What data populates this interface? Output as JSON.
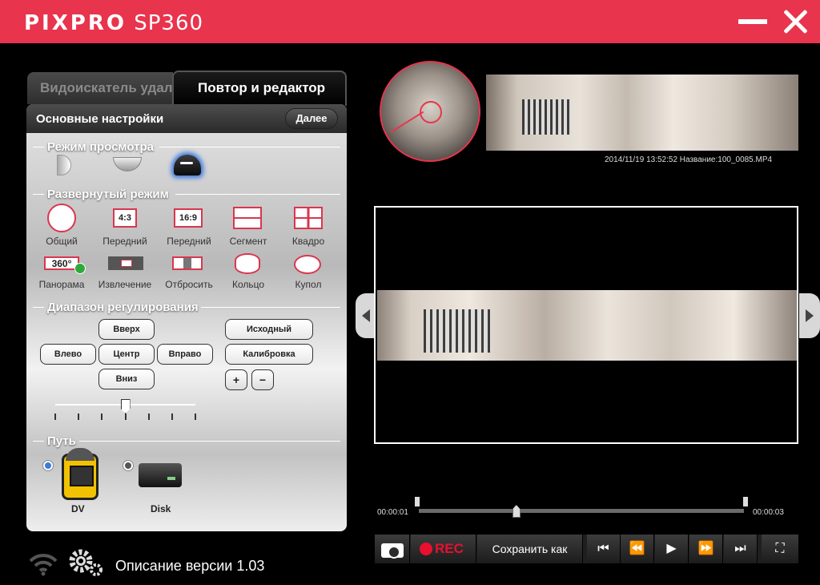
{
  "app": {
    "brand": "PIXPRO",
    "model": "SP360"
  },
  "tabs": {
    "viewfinder": "Видоискатель удал",
    "editor": "Повтор и редактор"
  },
  "panel": {
    "title": "Основные настройки",
    "next_label": "Далее"
  },
  "sections": {
    "view_mode": "Режим просмотра",
    "expand_mode": "Развернутый режим",
    "adjust_range": "Диапазон регулирования",
    "path": "Путь"
  },
  "view_modes": [
    {
      "name": "front",
      "selected": false
    },
    {
      "name": "ceiling",
      "selected": false
    },
    {
      "name": "dome",
      "selected": true
    }
  ],
  "expand_modes": [
    {
      "label": "Общий",
      "icon_text": ""
    },
    {
      "label": "Передний",
      "icon_text": "4:3"
    },
    {
      "label": "Передний",
      "icon_text": "16:9"
    },
    {
      "label": "Сегмент",
      "icon_text": ""
    },
    {
      "label": "Квадро",
      "icon_text": ""
    },
    {
      "label": "Панорама",
      "icon_text": "360°",
      "selected": true
    },
    {
      "label": "Извлечение",
      "icon_text": ""
    },
    {
      "label": "Отбросить",
      "icon_text": ""
    },
    {
      "label": "Кольцо",
      "icon_text": ""
    },
    {
      "label": "Купол",
      "icon_text": ""
    }
  ],
  "adjust": {
    "up": "Вверх",
    "left": "Влево",
    "center": "Центр",
    "right": "Вправо",
    "down": "Вниз",
    "original": "Исходный",
    "calibrate": "Калибровка",
    "zoom_in": "+",
    "zoom_out": "−",
    "slider_ticks": 7,
    "slider_value": 0.5
  },
  "path_devices": {
    "dv": {
      "label": "DV",
      "selected": true
    },
    "disk": {
      "label": "Disk",
      "selected": false
    }
  },
  "footer": {
    "version_text": "Описание версии 1.03"
  },
  "file_info": "2014/11/19 13:52:52 Название:100_0085.MP4",
  "timeline": {
    "start": "00:00:01",
    "end": "00:00:03",
    "position": 0.3
  },
  "controls": {
    "rec_label": "REC",
    "save_as_label": "Сохранить как",
    "first_glyph": "⏮",
    "rewind_glyph": "⏪",
    "play_glyph": "▶",
    "forward_glyph": "⏩",
    "last_glyph": "⏭",
    "fullscreen_glyph": "⛶"
  },
  "colors": {
    "titlebar": "#e8344d",
    "accent_red": "#e8102e",
    "selected_blue": "#3a78e0"
  }
}
